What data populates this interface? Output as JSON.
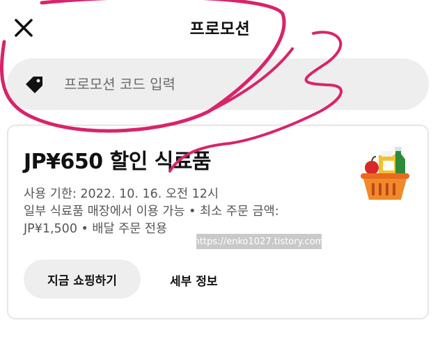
{
  "header": {
    "title": "프로모션",
    "close_icon": "close-icon"
  },
  "search": {
    "placeholder": "프로모션 코드 입력",
    "value": "",
    "icon": "tag-icon"
  },
  "promo": {
    "title": "JP¥650 할인 식료품",
    "expiry": "사용 기한: 2022. 10. 16. 오전 12시",
    "condition_line1": "일부 식료품 매장에서 이용 가능 • 최소 주문 금액:",
    "condition_line2": "JP¥1,500 • 배달 주문 전용",
    "icon": "grocery-basket-icon",
    "shop_button_label": "지금 쇼핑하기",
    "details_link_label": "세부 정보"
  },
  "watermark": "https://enko1027.tistory.com",
  "colors": {
    "annotation": "#d8246a",
    "pill_background": "#eeeeee",
    "card_border": "#e6e6e6"
  }
}
